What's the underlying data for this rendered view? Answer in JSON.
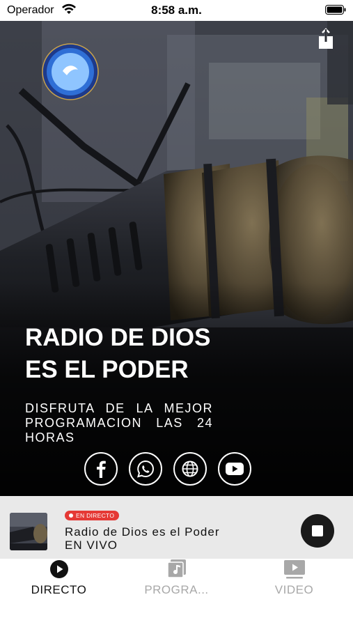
{
  "status_bar": {
    "carrier": "Operador",
    "time": "8:58 a.m."
  },
  "hero": {
    "title": "RADIO DE DIOS ES EL PODER",
    "subtitle": "DISFRUTA DE LA MEJOR PROGRAMACION LAS 24 HORAS",
    "socials": [
      "facebook-icon",
      "whatsapp-icon",
      "globe-icon",
      "youtube-icon"
    ]
  },
  "player": {
    "badge": "EN DIRECTO",
    "title": "Radio de Dios es el Poder",
    "subtitle": "EN VIVO",
    "accent": "#e53935"
  },
  "tabs": [
    {
      "label": "DIRECTO",
      "icon": "play-circle-icon",
      "active": true
    },
    {
      "label": "PROGRA...",
      "icon": "music-note-icon",
      "active": false
    },
    {
      "label": "VIDEO",
      "icon": "video-icon",
      "active": false
    }
  ]
}
